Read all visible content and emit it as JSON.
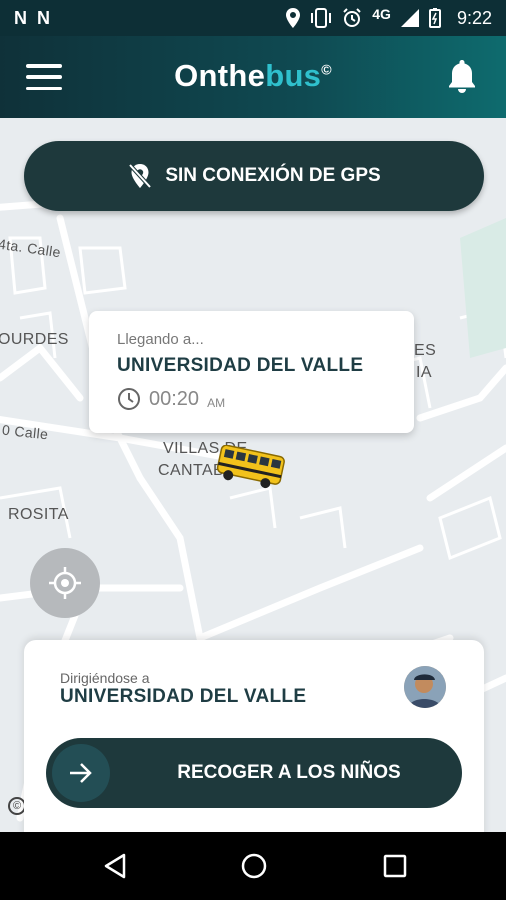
{
  "status_bar": {
    "left_icons": [
      "notification-n-icon",
      "notification-n-icon"
    ],
    "network": "4G",
    "time": "9:22"
  },
  "app_bar": {
    "brand_part1": "Onthe",
    "brand_part2": "bus",
    "brand_mark": "©"
  },
  "map": {
    "labels": [
      "4ta. Calle",
      "OURDES",
      "ES",
      "IA",
      "0 Calle",
      "VILLAS DE",
      "CANTAB",
      "ROSITA"
    ]
  },
  "gps_banner": {
    "label": "SIN CONEXIÓN DE GPS"
  },
  "arrival_card": {
    "label": "Llegando a...",
    "destination": "UNIVERSIDAD DEL VALLE",
    "time": "00:20",
    "ampm": "AM"
  },
  "bottom_card": {
    "label": "Dirigiéndose a",
    "destination": "UNIVERSIDAD DEL VALLE",
    "action_label": "RECOGER A LOS NIÑOS"
  },
  "colors": {
    "primary_dark": "#1e393c",
    "accent": "#2fc0cd",
    "appbar": "#0f4a52"
  }
}
